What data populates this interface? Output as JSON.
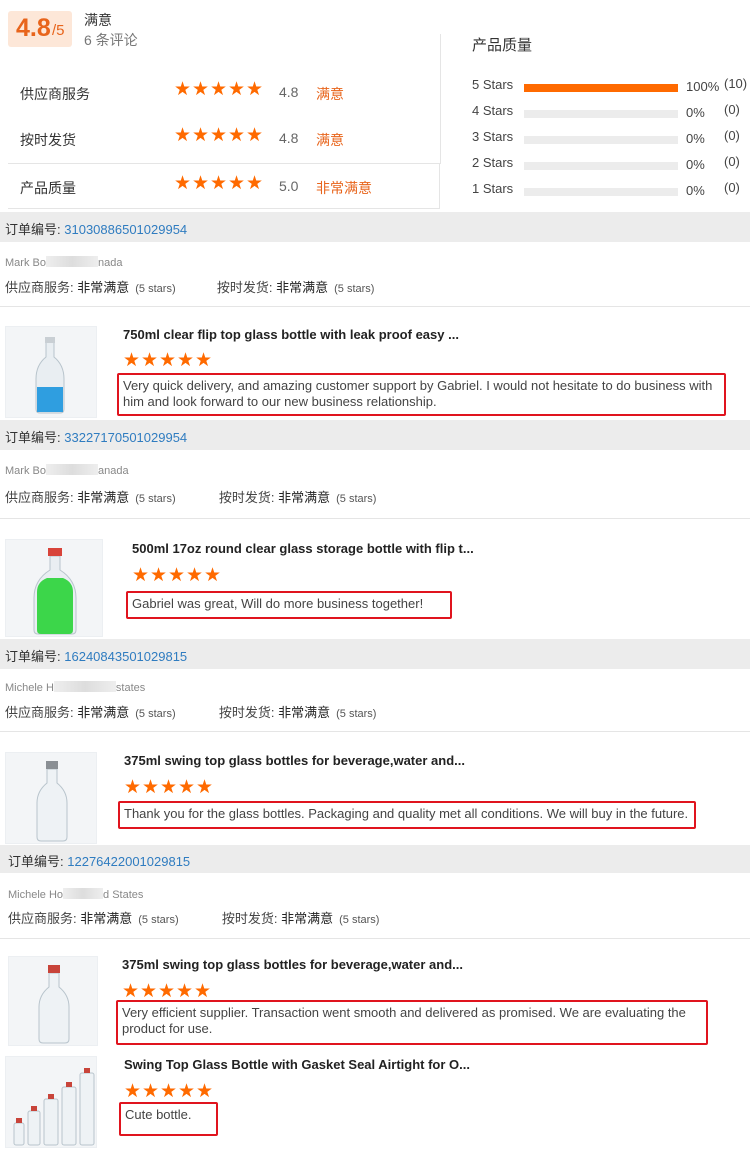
{
  "summary": {
    "score": "4.8",
    "score_denominator": "/5",
    "overall_level": "满意",
    "review_count": "6 条评论",
    "metrics": [
      {
        "label": "供应商服务",
        "score": "4.8",
        "level": "满意",
        "rating": 4.8
      },
      {
        "label": "按时发货",
        "score": "4.8",
        "level": "满意",
        "rating": 4.8
      },
      {
        "label": "产品质量",
        "score": "5.0",
        "level": "非常满意",
        "rating": 5.0
      }
    ],
    "product_quality_title": "产品质量",
    "distribution": [
      {
        "label": "5 Stars",
        "percent": "100%",
        "count": "(10)",
        "fill": 1.0
      },
      {
        "label": "4 Stars",
        "percent": "0%",
        "count": "(0)",
        "fill": 0
      },
      {
        "label": "3 Stars",
        "percent": "0%",
        "count": "(0)",
        "fill": 0
      },
      {
        "label": "2 Stars",
        "percent": "0%",
        "count": "(0)",
        "fill": 0
      },
      {
        "label": "1 Stars",
        "percent": "0%",
        "count": "(0)",
        "fill": 0
      }
    ]
  },
  "labels": {
    "order_prefix": "订单编号:",
    "supplier_service": "供应商服务:",
    "on_time": "按时发货:",
    "rating_value": "非常满意",
    "rating_note": "(5 stars)"
  },
  "colors": {
    "accent": "#ff6a00",
    "link": "#2f7cc0",
    "highlight_border": "#e0141e"
  },
  "reviews": [
    {
      "order_number": "31030886501029954",
      "reviewer_start": "Mark Bo",
      "reviewer_end": "nada",
      "products": [
        {
          "title": "750ml clear flip top glass bottle with leak proof easy ...",
          "rating": 5,
          "comment": "Very quick delivery, and amazing customer support by Gabriel. I would not hesitate to do business with him and look forward to our new business relationship."
        }
      ]
    },
    {
      "order_number": "33227170501029954",
      "reviewer_start": "Mark Bo",
      "reviewer_end": "anada",
      "products": [
        {
          "title": "500ml 17oz round clear glass storage bottle with flip t...",
          "rating": 5,
          "comment": "Gabriel was great, Will do more business together!"
        }
      ]
    },
    {
      "order_number": "16240843501029815",
      "reviewer_start": "Michele H",
      "reviewer_end": "states",
      "products": [
        {
          "title": "375ml swing top glass bottles for beverage,water and...",
          "rating": 5,
          "comment": "Thank you for the glass bottles. Packaging and quality met all conditions.  We will buy in the future."
        }
      ]
    },
    {
      "order_number": "12276422001029815",
      "reviewer_start": "Michele Ho",
      "reviewer_end": "d States",
      "products": [
        {
          "title": "375ml swing top glass bottles for beverage,water and...",
          "rating": 5,
          "comment": "Very efficient supplier. Transaction went smooth and delivered as promised. We are evaluating the product for use."
        },
        {
          "title": "Swing Top Glass Bottle with Gasket Seal Airtight for O...",
          "rating": 5,
          "comment": "Cute bottle."
        }
      ]
    }
  ]
}
